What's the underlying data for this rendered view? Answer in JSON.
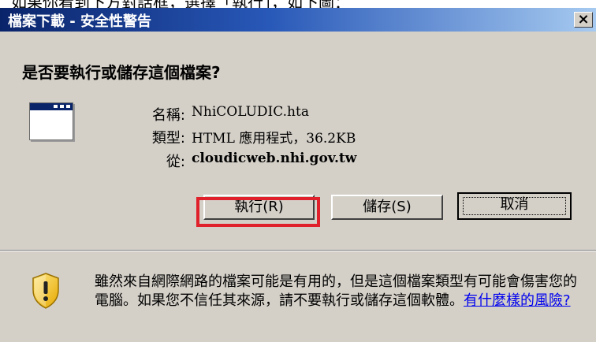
{
  "top_caption": "如果你看到下方對話框，選擇「執行」，如下圖：",
  "window": {
    "title": "檔案下載 - 安全性警告",
    "close_glyph": "×"
  },
  "question": "是否要執行或儲存這個檔案?",
  "file": {
    "name_label": "名稱:",
    "name_value": "NhiCOLUDIC.hta",
    "type_label": "類型:",
    "type_value": "HTML 應用程式，36.2KB",
    "from_label": "從:",
    "from_value": "cloudicweb.nhi.gov.tw",
    "icon": "application-window-icon"
  },
  "buttons": {
    "run_label": "執行",
    "run_key": "(R)",
    "save_label": "儲存",
    "save_key": "(S)",
    "cancel_label": "取消"
  },
  "warning": {
    "text": "雖然來自網際網路的檔案可能是有用的，但是這個檔案類型有可能會傷害您的電腦。如果您不信任其來源，請不要執行或儲存這個軟體。",
    "link": "有什麼樣的風險?",
    "icon": "security-shield-icon"
  },
  "colors": {
    "titlebar_start": "#0a246a",
    "titlebar_end": "#a6caf0",
    "highlight": "#e0202a",
    "dialog_bg": "#d4d0c8",
    "link": "#0000ee"
  }
}
